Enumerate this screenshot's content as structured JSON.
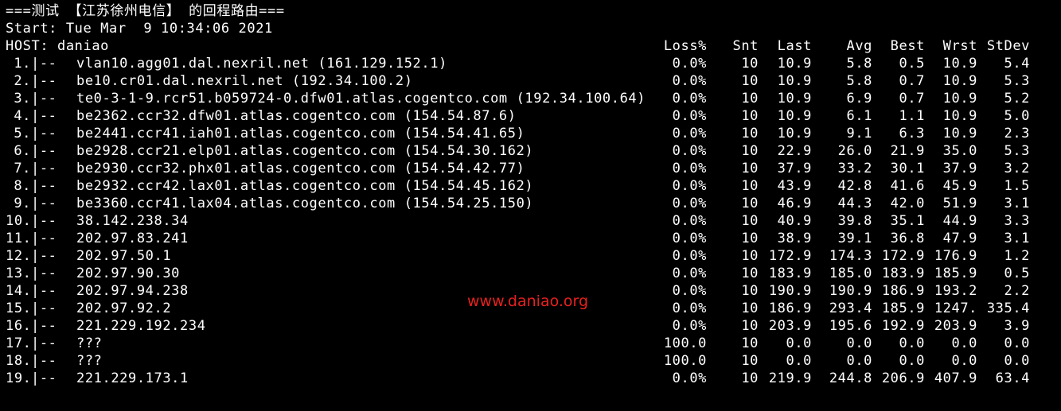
{
  "terminal": {
    "title_line": "===测试 【江苏徐州电信】 的回程路由===",
    "start_line": "Start: Tue Mar  9 10:34:06 2021",
    "host_line": "HOST: daniao"
  },
  "headers": {
    "loss": "Loss%",
    "snt": "Snt",
    "last": "Last",
    "avg": "Avg",
    "best": "Best",
    "wrst": "Wrst",
    "stdev": "StDev"
  },
  "hops": [
    {
      "num": "1.",
      "sep": "|--",
      "host": "vlan10.agg01.dal.nexril.net (161.129.152.1)",
      "loss": "0.0%",
      "snt": "10",
      "last": "10.9",
      "avg": "5.8",
      "best": "0.5",
      "wrst": "10.9",
      "stdev": "5.4"
    },
    {
      "num": "2.",
      "sep": "|--",
      "host": "be10.cr01.dal.nexril.net (192.34.100.2)",
      "loss": "0.0%",
      "snt": "10",
      "last": "10.9",
      "avg": "5.8",
      "best": "0.7",
      "wrst": "10.9",
      "stdev": "5.3"
    },
    {
      "num": "3.",
      "sep": "|--",
      "host": "te0-3-1-9.rcr51.b059724-0.dfw01.atlas.cogentco.com (192.34.100.64)",
      "loss": "0.0%",
      "snt": "10",
      "last": "10.9",
      "avg": "6.9",
      "best": "0.7",
      "wrst": "10.9",
      "stdev": "5.2"
    },
    {
      "num": "4.",
      "sep": "|--",
      "host": "be2362.ccr32.dfw01.atlas.cogentco.com (154.54.87.6)",
      "loss": "0.0%",
      "snt": "10",
      "last": "10.9",
      "avg": "6.1",
      "best": "1.1",
      "wrst": "10.9",
      "stdev": "5.0"
    },
    {
      "num": "5.",
      "sep": "|--",
      "host": "be2441.ccr41.iah01.atlas.cogentco.com (154.54.41.65)",
      "loss": "0.0%",
      "snt": "10",
      "last": "10.9",
      "avg": "9.1",
      "best": "6.3",
      "wrst": "10.9",
      "stdev": "2.3"
    },
    {
      "num": "6.",
      "sep": "|--",
      "host": "be2928.ccr21.elp01.atlas.cogentco.com (154.54.30.162)",
      "loss": "0.0%",
      "snt": "10",
      "last": "22.9",
      "avg": "26.0",
      "best": "21.9",
      "wrst": "35.0",
      "stdev": "5.3"
    },
    {
      "num": "7.",
      "sep": "|--",
      "host": "be2930.ccr32.phx01.atlas.cogentco.com (154.54.42.77)",
      "loss": "0.0%",
      "snt": "10",
      "last": "37.9",
      "avg": "33.2",
      "best": "30.1",
      "wrst": "37.9",
      "stdev": "3.2"
    },
    {
      "num": "8.",
      "sep": "|--",
      "host": "be2932.ccr42.lax01.atlas.cogentco.com (154.54.45.162)",
      "loss": "0.0%",
      "snt": "10",
      "last": "43.9",
      "avg": "42.8",
      "best": "41.6",
      "wrst": "45.9",
      "stdev": "1.5"
    },
    {
      "num": "9.",
      "sep": "|--",
      "host": "be3360.ccr41.lax04.atlas.cogentco.com (154.54.25.150)",
      "loss": "0.0%",
      "snt": "10",
      "last": "46.9",
      "avg": "44.3",
      "best": "42.0",
      "wrst": "51.9",
      "stdev": "3.1"
    },
    {
      "num": "10.",
      "sep": "|--",
      "host": "38.142.238.34",
      "loss": "0.0%",
      "snt": "10",
      "last": "40.9",
      "avg": "39.8",
      "best": "35.1",
      "wrst": "44.9",
      "stdev": "3.3"
    },
    {
      "num": "11.",
      "sep": "|--",
      "host": "202.97.83.241",
      "loss": "0.0%",
      "snt": "10",
      "last": "38.9",
      "avg": "39.1",
      "best": "36.8",
      "wrst": "47.9",
      "stdev": "3.1"
    },
    {
      "num": "12.",
      "sep": "|--",
      "host": "202.97.50.1",
      "loss": "0.0%",
      "snt": "10",
      "last": "172.9",
      "avg": "174.3",
      "best": "172.9",
      "wrst": "176.9",
      "stdev": "1.2"
    },
    {
      "num": "13.",
      "sep": "|--",
      "host": "202.97.90.30",
      "loss": "0.0%",
      "snt": "10",
      "last": "183.9",
      "avg": "185.0",
      "best": "183.9",
      "wrst": "185.9",
      "stdev": "0.5"
    },
    {
      "num": "14.",
      "sep": "|--",
      "host": "202.97.94.238",
      "loss": "0.0%",
      "snt": "10",
      "last": "190.9",
      "avg": "190.9",
      "best": "186.9",
      "wrst": "193.2",
      "stdev": "2.2"
    },
    {
      "num": "15.",
      "sep": "|--",
      "host": "202.97.92.2",
      "loss": "0.0%",
      "snt": "10",
      "last": "186.9",
      "avg": "293.4",
      "best": "185.9",
      "wrst": "1247.",
      "stdev": "335.4"
    },
    {
      "num": "16.",
      "sep": "|--",
      "host": "221.229.192.234",
      "loss": "0.0%",
      "snt": "10",
      "last": "203.9",
      "avg": "195.6",
      "best": "192.9",
      "wrst": "203.9",
      "stdev": "3.9"
    },
    {
      "num": "17.",
      "sep": "|--",
      "host": "???",
      "loss": "100.0",
      "snt": "10",
      "last": "0.0",
      "avg": "0.0",
      "best": "0.0",
      "wrst": "0.0",
      "stdev": "0.0"
    },
    {
      "num": "18.",
      "sep": "|--",
      "host": "???",
      "loss": "100.0",
      "snt": "10",
      "last": "0.0",
      "avg": "0.0",
      "best": "0.0",
      "wrst": "0.0",
      "stdev": "0.0"
    },
    {
      "num": "19.",
      "sep": "|--",
      "host": "221.229.173.1",
      "loss": "0.0%",
      "snt": "10",
      "last": "219.9",
      "avg": "244.8",
      "best": "206.9",
      "wrst": "407.9",
      "stdev": "63.4"
    }
  ],
  "watermark": {
    "text": "www.daniao.org",
    "color": "#e8201f"
  },
  "colors": {
    "background": "#000000",
    "text": "#ffffff"
  }
}
